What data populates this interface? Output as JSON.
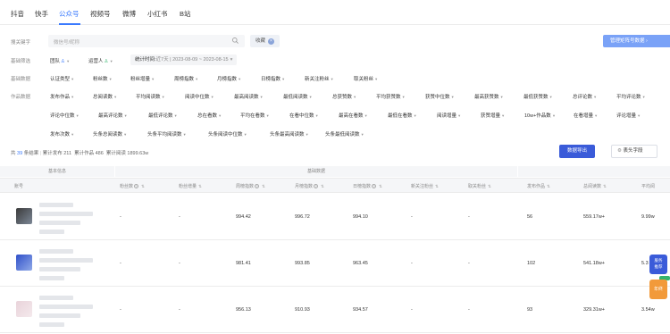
{
  "platform_tabs": [
    "抖音",
    "快手",
    "公众号",
    "视频号",
    "微博",
    "小红书",
    "B站"
  ],
  "search": {
    "label": "搜关键字",
    "placeholder": "微信号/昵称",
    "collect_chip": "收藏"
  },
  "manage_button": "管理矩阵号数据",
  "basic_filter": {
    "label": "基础筛选",
    "team": "团队",
    "operator": "运营人",
    "date_label": "统计时间:",
    "date_value": "近7天 | 2023-08-09 ~ 2023-08-15"
  },
  "basic_data": {
    "label": "基础数据",
    "items": [
      "认证类型",
      "粉丝数",
      "粉丝增量",
      "周榜指数",
      "月榜指数",
      "日榜指数",
      "新关注粉丝",
      "取关粉丝"
    ]
  },
  "works_data": {
    "label": "作品数据",
    "row1": [
      "发布作品",
      "总阅读数",
      "平均阅读数",
      "阅读中位数",
      "最高阅读数",
      "最低阅读数",
      "总获赞数",
      "平均获赞数",
      "获赞中位数",
      "最高获赞数",
      "最低获赞数",
      "总评论数",
      "平均评论数"
    ],
    "row2": [
      "评论中位数",
      "最高评论数",
      "最低评论数",
      "总在看数",
      "平均在看数",
      "在看中位数",
      "最高在看数",
      "最低在看数",
      "阅读增量",
      "获赞增量",
      "10w+作品数",
      "在看增量",
      "评论增量"
    ],
    "row3": [
      "发布次数",
      "头条总阅读数",
      "头条平均阅读数",
      "头条阅读中位数",
      "头条最高阅读数",
      "头条最低阅读数"
    ]
  },
  "summary": {
    "prefix": "共",
    "count": "39",
    "suffix": "条结果",
    "published": "累计发布 211",
    "works": "累计作品 486",
    "reads": "累计阅读 1899.63w"
  },
  "export_button": "数据导出",
  "header_fields_button": "表头字段",
  "table": {
    "group_basic": "基本信息",
    "group_data": "基础数据",
    "columns": [
      "账号",
      "粉丝数",
      "粉丝增量",
      "周榜指数",
      "月榜指数",
      "日榜指数",
      "新关注粉丝",
      "取关粉丝",
      "发布作品",
      "总阅读数",
      "平均阅"
    ],
    "rows": [
      {
        "fans": "-",
        "fans_inc": "-",
        "week": "994.42",
        "month": "996.72",
        "day": "994.10",
        "new_follow": "-",
        "unfollow": "-",
        "posts": "56",
        "reads": "559.17w+",
        "avg": "9.99w"
      },
      {
        "fans": "-",
        "fans_inc": "-",
        "week": "981.41",
        "month": "993.85",
        "day": "963.45",
        "new_follow": "-",
        "unfollow": "-",
        "posts": "102",
        "reads": "541.18w+",
        "avg": "5.3"
      },
      {
        "fans": "-",
        "fans_inc": "-",
        "week": "956.13",
        "month": "910.93",
        "day": "934.57",
        "new_follow": "-",
        "unfollow": "-",
        "posts": "93",
        "reads": "329.31w+",
        "avg": "3.54w"
      }
    ]
  },
  "float_buttons": {
    "a": [
      "服务",
      "推荐"
    ],
    "b": "年终"
  },
  "colors": {
    "primary": "#3a7afe",
    "export": "#3a5bd9",
    "manage": "#7aa2f7"
  }
}
